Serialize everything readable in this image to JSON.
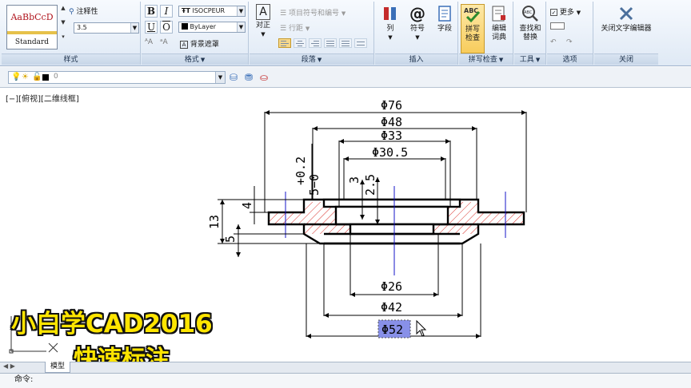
{
  "ribbon": {
    "style_panel": {
      "title": "样式",
      "sample_text": "AaBbCcD",
      "style_name": "Standard",
      "annotative_label": "注释性",
      "height_value": "3.5"
    },
    "format_panel": {
      "title": "格式",
      "bold": "B",
      "italic": "I",
      "underline": "U",
      "overline": "O",
      "font": "ISOCPEUR",
      "color": "ByLayer",
      "bg_mask": "背景遮罩"
    },
    "paragraph_panel": {
      "title": "段落",
      "justify_label": "对正",
      "bullets_label": "项目符号和编号",
      "linespacing_label": "行距"
    },
    "insert_panel": {
      "title": "插入",
      "column_label": "列",
      "symbol_label": "符号",
      "field_label": "字段"
    },
    "spell_panel": {
      "title": "拼写检查",
      "spellcheck_label_1": "拼写",
      "spellcheck_label_2": "检查",
      "dict_label_1": "编辑",
      "dict_label_2": "词典"
    },
    "tools_panel": {
      "title": "工具",
      "findreplace_label_1": "查找和",
      "findreplace_label_2": "替换"
    },
    "options_panel": {
      "title": "选项",
      "more_label": "更多"
    },
    "close_panel": {
      "title": "关闭",
      "close_label": "关闭文字编辑器"
    }
  },
  "toolbar": {
    "layer_value": "0"
  },
  "viewport": {
    "label": "[−][俯视][二维线框]"
  },
  "drawing": {
    "dims": {
      "d76": "Φ76",
      "d48": "Φ48",
      "d33": "Φ33",
      "d305": "Φ30.5",
      "d26": "Φ26",
      "d42": "Φ42",
      "d52": "Φ52",
      "v13": "13",
      "v5": "5",
      "v4": "4",
      "v3": "3",
      "v25": "2.5",
      "tol": "+0.2",
      "tol2": "5−0"
    }
  },
  "overlay": {
    "title": "小白学CAD2016",
    "subtitle": "快速标注"
  },
  "tabs": {
    "model": "模型"
  },
  "command": {
    "prompt": "命令:"
  },
  "colors": {
    "ribbon_bg": "#dfe9f5",
    "hatch": "#d9302a",
    "centerline": "#1515c8",
    "highlight": "#8890e8",
    "overlay_text": "#ffe500"
  }
}
